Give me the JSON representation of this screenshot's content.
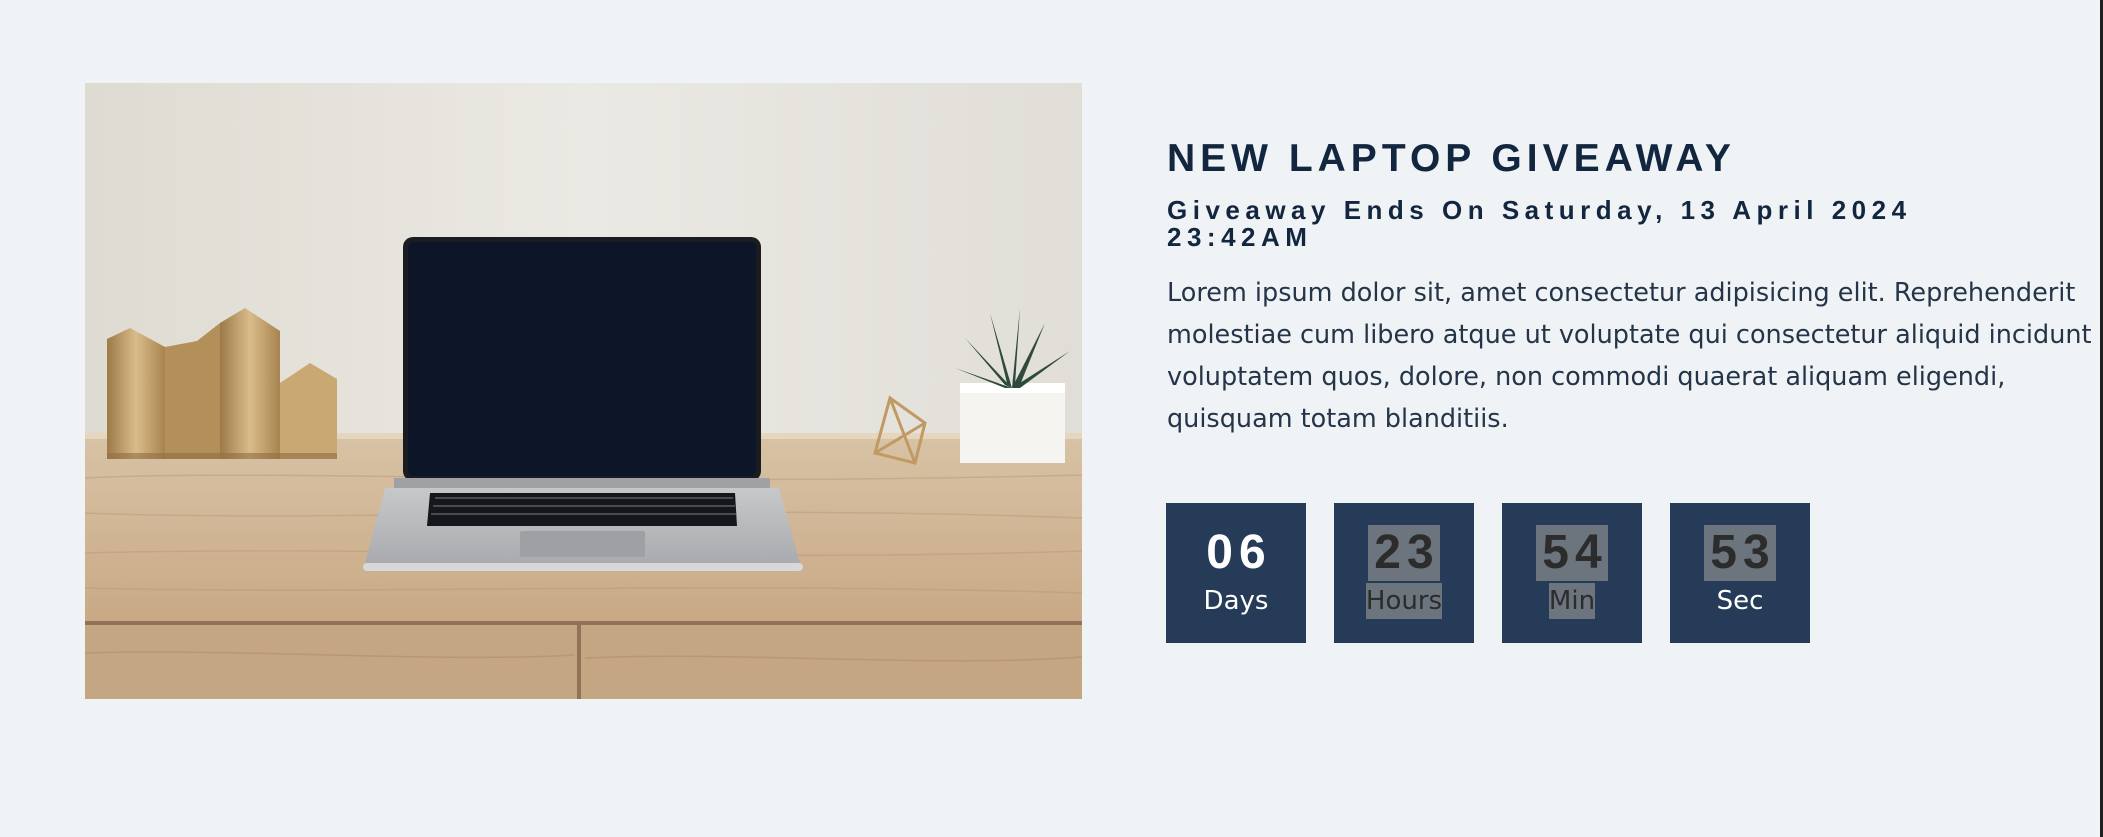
{
  "giveaway": {
    "title": "NEW LAPTOP GIVEAWAY",
    "subtitle": "Giveaway Ends On Saturday, 13 April 2024 23:42AM",
    "description": "Lorem ipsum dolor sit, amet consectetur adipisicing elit. Reprehenderit molestiae cum libero atque ut voluptate qui consectetur aliquid incidunt voluptatem quos, dolore, non commodi quaerat aliquam eligendi, quisquam totam blanditiis."
  },
  "countdown": [
    {
      "value": "06",
      "label": "Days"
    },
    {
      "value": "23",
      "label": "Hours"
    },
    {
      "value": "54",
      "label": "Min"
    },
    {
      "value": "53",
      "label": "Sec"
    }
  ],
  "colors": {
    "page_background": "#f0f3f6",
    "title": "#13263f",
    "countdown_box": "#253b57",
    "selection_highlight": "#6c747e"
  },
  "image": {
    "icon": "laptop-on-desk-photo"
  }
}
